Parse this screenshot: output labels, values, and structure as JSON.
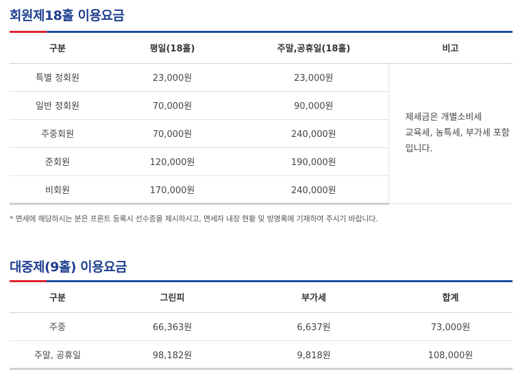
{
  "section1": {
    "title": "회원제18홀 이용요금",
    "headers": [
      "구분",
      "평일(18홀)",
      "주말,공휴일(18홀)",
      "비고"
    ],
    "rows": [
      [
        "특별 정회원",
        "23,000원",
        "23,000원"
      ],
      [
        "일반 정회원",
        "70,000원",
        "90,000원"
      ],
      [
        "주중회원",
        "70,000원",
        "240,000원"
      ],
      [
        "준회원",
        "120,000원",
        "190,000원"
      ],
      [
        "비회원",
        "170,000원",
        "240,000원"
      ]
    ],
    "note_lines": [
      "제세금은 개별소비세",
      "교육세, 농특세, 부가세 포함",
      "입니다."
    ],
    "footnote": "* 면세에 해당하시는 분은 프론트 등록시 선수증을 제시하시고, 면세자 내장 현황 및 방명록에 기재하여 주시기 바랍니다."
  },
  "section2": {
    "title": "대중제(9홀) 이용요금",
    "headers": [
      "구분",
      "그린피",
      "부가세",
      "합계"
    ],
    "rows": [
      [
        "주중",
        "66,363원",
        "6,637원",
        "73,000원"
      ],
      [
        "주말, 공휴일",
        "98,182원",
        "9,818원",
        "108,000원"
      ]
    ]
  },
  "colors": {
    "title": "#1f3f8f",
    "bar": "#1f4ea3",
    "accent": "#e0212d"
  }
}
